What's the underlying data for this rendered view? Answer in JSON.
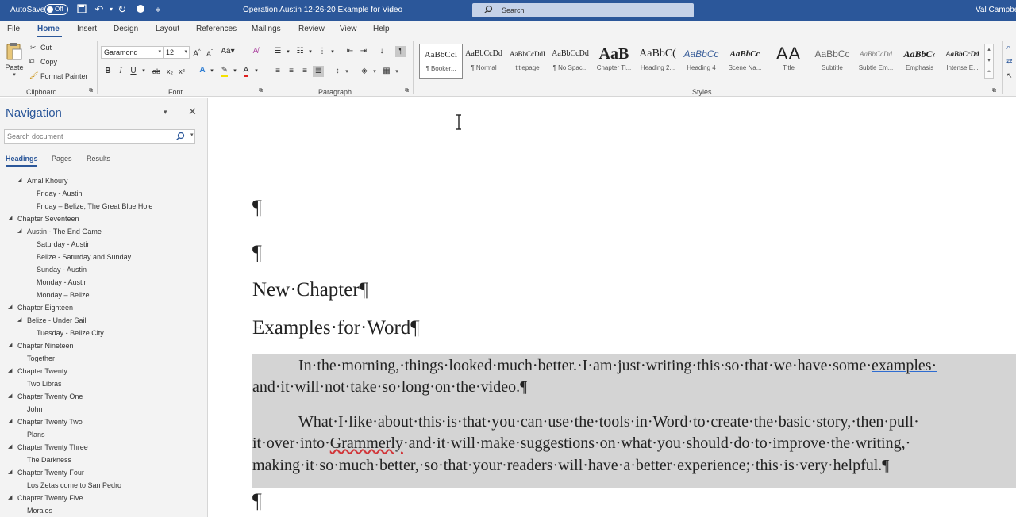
{
  "titlebar": {
    "autosave_label": "AutoSave",
    "autosave_state": "Off",
    "doc_title": "Operation Austin 12-26-20 Example for Video",
    "search_placeholder": "Search",
    "user_name": "Val Campbe"
  },
  "tabs": [
    "File",
    "Home",
    "Insert",
    "Design",
    "Layout",
    "References",
    "Mailings",
    "Review",
    "View",
    "Help"
  ],
  "active_tab": "Home",
  "ribbon": {
    "clipboard": {
      "paste": "Paste",
      "cut": "Cut",
      "copy": "Copy",
      "format_painter": "Format Painter",
      "label": "Clipboard"
    },
    "font": {
      "name": "Garamond",
      "size": "12",
      "label": "Font"
    },
    "paragraph": {
      "label": "Paragraph"
    },
    "styles": {
      "label": "Styles",
      "items": [
        {
          "preview": "AaBbCcI",
          "name": "¶ Booker..."
        },
        {
          "preview": "AaBbCcDd",
          "name": "¶ Normal"
        },
        {
          "preview": "AaBbCcDdI",
          "name": "titlepage"
        },
        {
          "preview": "AaBbCcDd",
          "name": "¶ No Spac..."
        },
        {
          "preview": "AaB",
          "name": "Chapter Ti..."
        },
        {
          "preview": "AaBbC(",
          "name": "Heading 2..."
        },
        {
          "preview": "AaBbCc",
          "name": "Heading 4"
        },
        {
          "preview": "AaBbCc",
          "name": "Scene Na..."
        },
        {
          "preview": "AA",
          "name": "Title"
        },
        {
          "preview": "AaBbCc",
          "name": "Subtitle"
        },
        {
          "preview": "AaBbCcDd",
          "name": "Subtle Em..."
        },
        {
          "preview": "AaBbC‹",
          "name": "Emphasis"
        },
        {
          "preview": "AaBbCcDd",
          "name": "Intense E..."
        }
      ]
    }
  },
  "navigation": {
    "title": "Navigation",
    "search_placeholder": "Search document",
    "tabs": [
      "Headings",
      "Pages",
      "Results"
    ],
    "active_tab": "Headings",
    "items": [
      {
        "label": "Amal Khoury",
        "level": 2,
        "expanded": true
      },
      {
        "label": "Friday - Austin",
        "level": 3
      },
      {
        "label": "Friday – Belize, The Great Blue Hole",
        "level": 3
      },
      {
        "label": "Chapter Seventeen",
        "level": 1,
        "expanded": true
      },
      {
        "label": "Austin - The End Game",
        "level": 2,
        "expanded": true
      },
      {
        "label": "Saturday - Austin",
        "level": 3
      },
      {
        "label": "Belize - Saturday and Sunday",
        "level": 3
      },
      {
        "label": "Sunday - Austin",
        "level": 3
      },
      {
        "label": "Monday - Austin",
        "level": 3
      },
      {
        "label": "Monday – Belize",
        "level": 3
      },
      {
        "label": "Chapter Eighteen",
        "level": 1,
        "expanded": true
      },
      {
        "label": "Belize - Under Sail",
        "level": 2,
        "expanded": true
      },
      {
        "label": "Tuesday - Belize City",
        "level": 3
      },
      {
        "label": "Chapter Nineteen",
        "level": 1,
        "expanded": true
      },
      {
        "label": "Together",
        "level": 2
      },
      {
        "label": "Chapter Twenty",
        "level": 1,
        "expanded": true
      },
      {
        "label": "Two Libras",
        "level": 2
      },
      {
        "label": "Chapter Twenty One",
        "level": 1,
        "expanded": true
      },
      {
        "label": "John",
        "level": 2
      },
      {
        "label": "Chapter Twenty Two",
        "level": 1,
        "expanded": true
      },
      {
        "label": "Plans",
        "level": 2
      },
      {
        "label": "Chapter Twenty Three",
        "level": 1,
        "expanded": true
      },
      {
        "label": "The Darkness",
        "level": 2
      },
      {
        "label": "Chapter Twenty Four",
        "level": 1,
        "expanded": true
      },
      {
        "label": "Los Zetas come to San Pedro",
        "level": 2
      },
      {
        "label": "Chapter Twenty Five",
        "level": 1,
        "expanded": true
      },
      {
        "label": "Morales",
        "level": 2
      }
    ]
  },
  "document": {
    "pilcrow": "¶",
    "heading1": "New·Chapter¶",
    "heading2": "Examples·for·Word¶",
    "para1_lines": [
      "In·the·morning,·things·looked·much·better.·I·am·just·writing·this·so·that·we·have·some·",
      "and·it·will·not·take·so·long·on·the·video.¶"
    ],
    "para1_underlined_word": "examples·",
    "para2_lines": [
      "What·I·like·about·this·is·that·you·can·use·the·tools·in·Word·to·create·the·basic·story,·then·pull·",
      "it·over·into·",
      "·and·it·will·make·suggestions·on·what·you·should·do·to·improve·the·writing,·",
      "making·it·so·much·better,·so·that·your·readers·will·have·a·better·experience;·this·is·very·helpful.¶"
    ],
    "para2_misspelled": "Grammerly"
  },
  "colors": {
    "word_blue": "#2b579a",
    "selection_gray": "#d4d4d4",
    "ribbon_bg": "#f3f3f3"
  }
}
